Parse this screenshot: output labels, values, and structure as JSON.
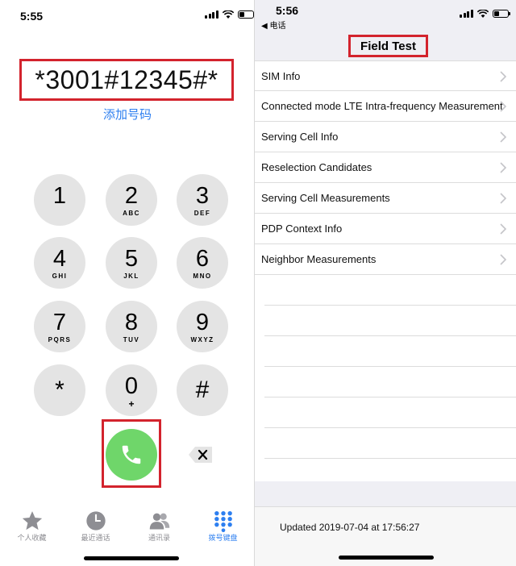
{
  "dialer": {
    "status_time": "5:55",
    "dialed_number": "*3001#12345#*",
    "add_number_label": "添加号码",
    "keys": [
      {
        "digit": "1",
        "letters": ""
      },
      {
        "digit": "2",
        "letters": "ABC"
      },
      {
        "digit": "3",
        "letters": "DEF"
      },
      {
        "digit": "4",
        "letters": "GHI"
      },
      {
        "digit": "5",
        "letters": "JKL"
      },
      {
        "digit": "6",
        "letters": "MNO"
      },
      {
        "digit": "7",
        "letters": "PQRS"
      },
      {
        "digit": "8",
        "letters": "TUV"
      },
      {
        "digit": "9",
        "letters": "WXYZ"
      },
      {
        "digit": "*",
        "letters": ""
      },
      {
        "digit": "0",
        "letters": "+"
      },
      {
        "digit": "#",
        "letters": ""
      }
    ],
    "call_icon": "phone-icon",
    "delete_icon": "backspace-icon",
    "tabs": [
      {
        "label": "个人收藏",
        "icon": "star-icon",
        "active": false
      },
      {
        "label": "最近通话",
        "icon": "clock-icon",
        "active": false
      },
      {
        "label": "通讯录",
        "icon": "contacts-icon",
        "active": false
      },
      {
        "label": "拨号键盘",
        "icon": "keypad-icon",
        "active": true
      }
    ],
    "colors": {
      "call_green": "#6fd66a",
      "accent_blue": "#2d7ff0",
      "highlight_red": "#d3232d",
      "key_gray": "#e4e4e4"
    }
  },
  "field_test": {
    "status_time": "5:56",
    "back_label": "◀ 电话",
    "title": "Field Test",
    "items": [
      "SIM Info",
      "Connected mode LTE Intra-frequency Measurement",
      "Serving Cell Info",
      "Reselection Candidates",
      "Serving Cell Measurements",
      "PDP Context Info",
      "Neighbor Measurements"
    ],
    "updated_text": "Updated 2019-07-04 at 17:56:27"
  }
}
